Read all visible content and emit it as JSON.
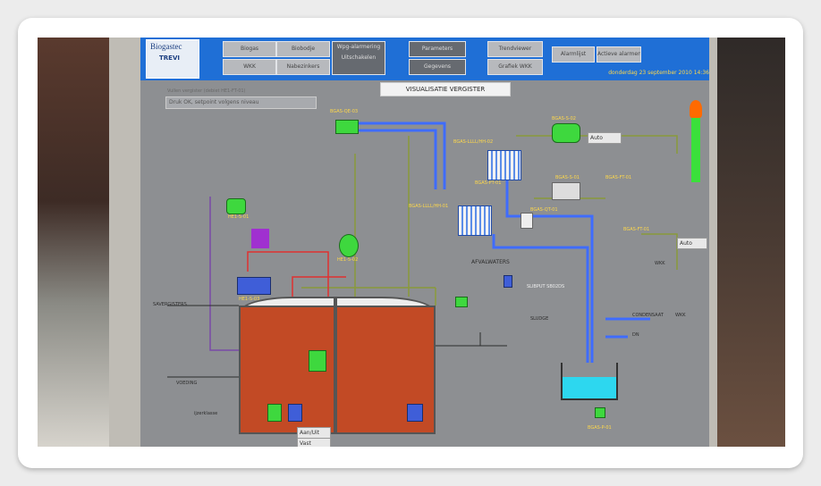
{
  "photo_subject": "monitor displaying SCADA biogas plant visualization",
  "header": {
    "logo_line1": "Biogastec",
    "logo_line2": "TREVI",
    "buttons": [
      "Biogas",
      "Biobodje",
      "WKK",
      "Nabezinkers",
      "Wpg-alarmering Uitschakelen",
      "Parameters",
      "Gegevens",
      "Trendviewer",
      "Grafiek WKK",
      "Alarmlijst",
      "Actieve alarmen"
    ],
    "date": "donderdag 23 september 2010 14:36"
  },
  "title": "VISUALISATIE VERGISTER",
  "dropdown": {
    "label": "Vullen vergister (debiet HE1-FT-01)",
    "value": "Druk OK, setpoint volgens niveau"
  },
  "labels": {
    "bgas_qe": "BGAS-QE-03",
    "bgas_s02": "BGAS-S-02",
    "bgas_lll": "BGAS-LLLL/HH-02",
    "bgas_s01": "BGAS-S-01",
    "bgas_pt": "BGAS-PT-01",
    "bgas_qt": "BGAS-QT-01",
    "bgas_lll2": "BGAS-LLLL/HH-01",
    "bgas_ft": "BGAS-FT-01",
    "bgas_ft2": "BGAS-FT-01",
    "auto1": "Auto",
    "auto2": "Auto",
    "he1_s01": "HE1-S-01",
    "he1_s02": "HE1-S-02",
    "he1_s03": "HE1-S-03",
    "afvalwater": "AFVALWATERS",
    "sludge": "SLUDGE",
    "slibbuffer": "SLIBPUT SB02DS",
    "condensaat": "CONDENSAAT",
    "wkk": "WKK",
    "wkk2": "WKK",
    "dn": "DN",
    "saververgisters": "SAVERGISTERS",
    "voeding": "VOEDING",
    "ijzerklasse": "ijzerklasse",
    "aan_uit": "Aan/Uit",
    "vast": "Vast",
    "bgas_p01": "BGAS-P-01"
  },
  "colors": {
    "screen_bg": "#8d8f92",
    "topbar": "#1f6fd6",
    "tank": "#c24a25",
    "pipe_blue": "#3f6cff",
    "pipe_green": "#8a9a3a",
    "label": "#ffd84a"
  }
}
